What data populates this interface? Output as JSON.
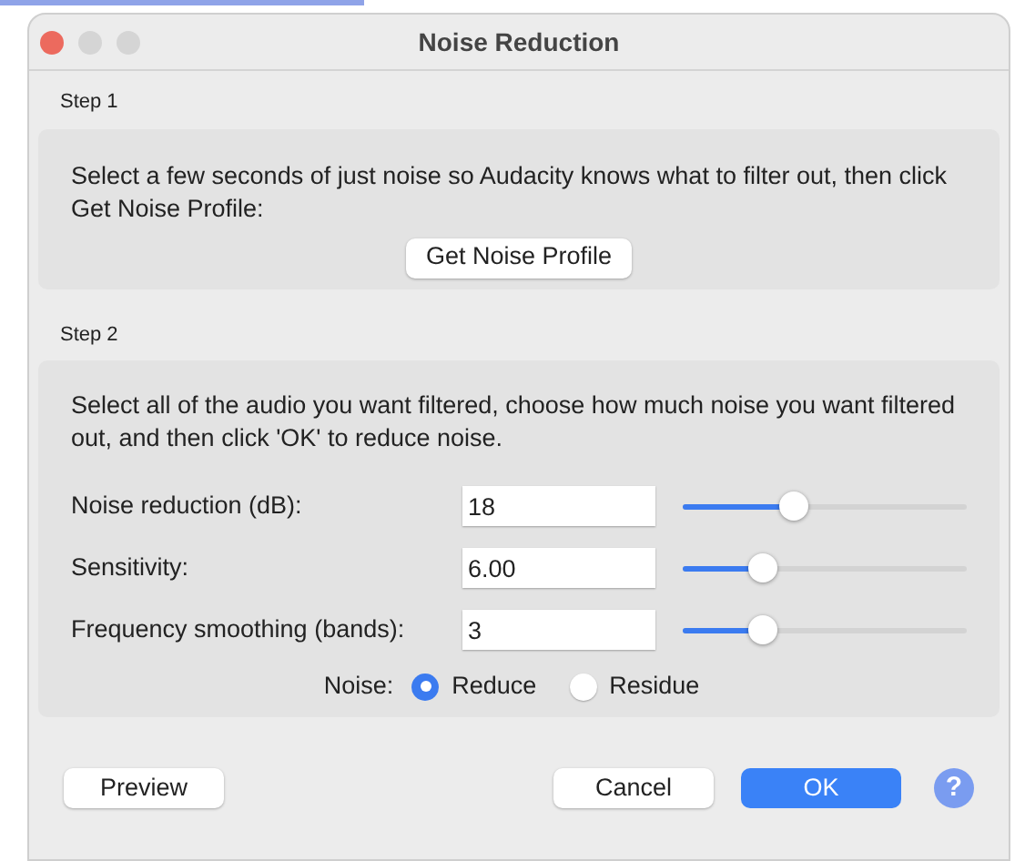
{
  "window": {
    "title": "Noise Reduction"
  },
  "step1": {
    "label": "Step 1",
    "text": "Select a few seconds of just noise so Audacity knows what to filter out, then click Get Noise Profile:",
    "button": "Get Noise Profile"
  },
  "step2": {
    "label": "Step 2",
    "text": "Select all of the audio you want filtered, choose how much noise you want filtered out, and then click 'OK' to reduce noise.",
    "settings": [
      {
        "label": "Noise reduction (dB):",
        "value": "18",
        "level": 0.39
      },
      {
        "label": "Sensitivity:",
        "value": "6.00",
        "level": 0.28
      },
      {
        "label": "Frequency smoothing (bands):",
        "value": "3",
        "level": 0.28
      }
    ],
    "noise": {
      "label": "Noise:",
      "options": [
        {
          "label": "Reduce",
          "selected": true
        },
        {
          "label": "Residue",
          "selected": false
        }
      ]
    }
  },
  "buttons": {
    "preview": "Preview",
    "cancel": "Cancel",
    "ok": "OK",
    "help": "?"
  }
}
